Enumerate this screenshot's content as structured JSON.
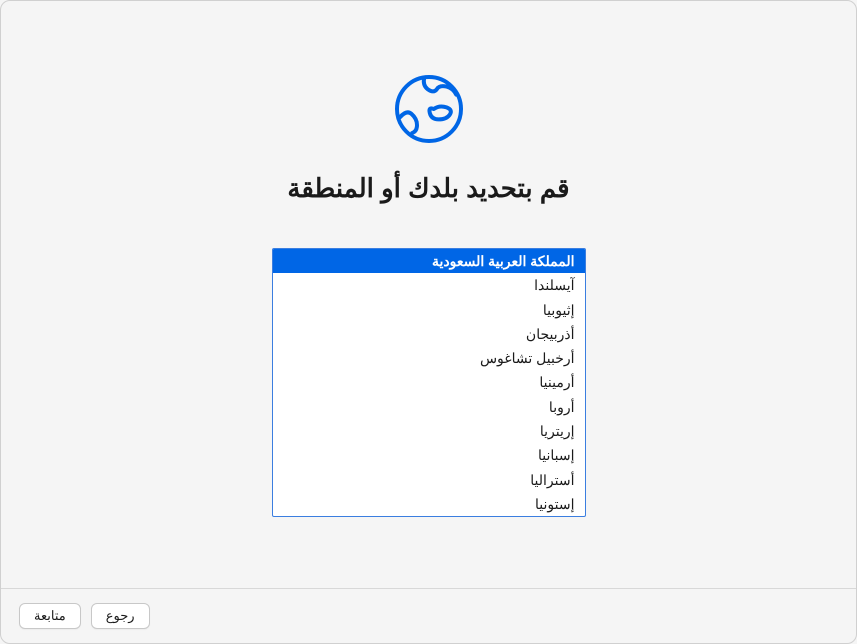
{
  "title": "قم بتحديد بلدك أو المنطقة",
  "countries": [
    {
      "label": "المملكة العربية السعودية",
      "selected": true
    },
    {
      "label": "آيسلندا",
      "selected": false
    },
    {
      "label": "إثيوبيا",
      "selected": false
    },
    {
      "label": "أذربيجان",
      "selected": false
    },
    {
      "label": "أرخبيل تشاغوس",
      "selected": false
    },
    {
      "label": "أرمينيا",
      "selected": false
    },
    {
      "label": "أروبا",
      "selected": false
    },
    {
      "label": "إريتريا",
      "selected": false
    },
    {
      "label": "إسبانيا",
      "selected": false
    },
    {
      "label": "أستراليا",
      "selected": false
    },
    {
      "label": "إستونيا",
      "selected": false
    }
  ],
  "footer": {
    "continue": "متابعة",
    "back": "رجوع"
  },
  "colors": {
    "accent": "#0066e6",
    "border_focus": "#3b7ee0"
  }
}
